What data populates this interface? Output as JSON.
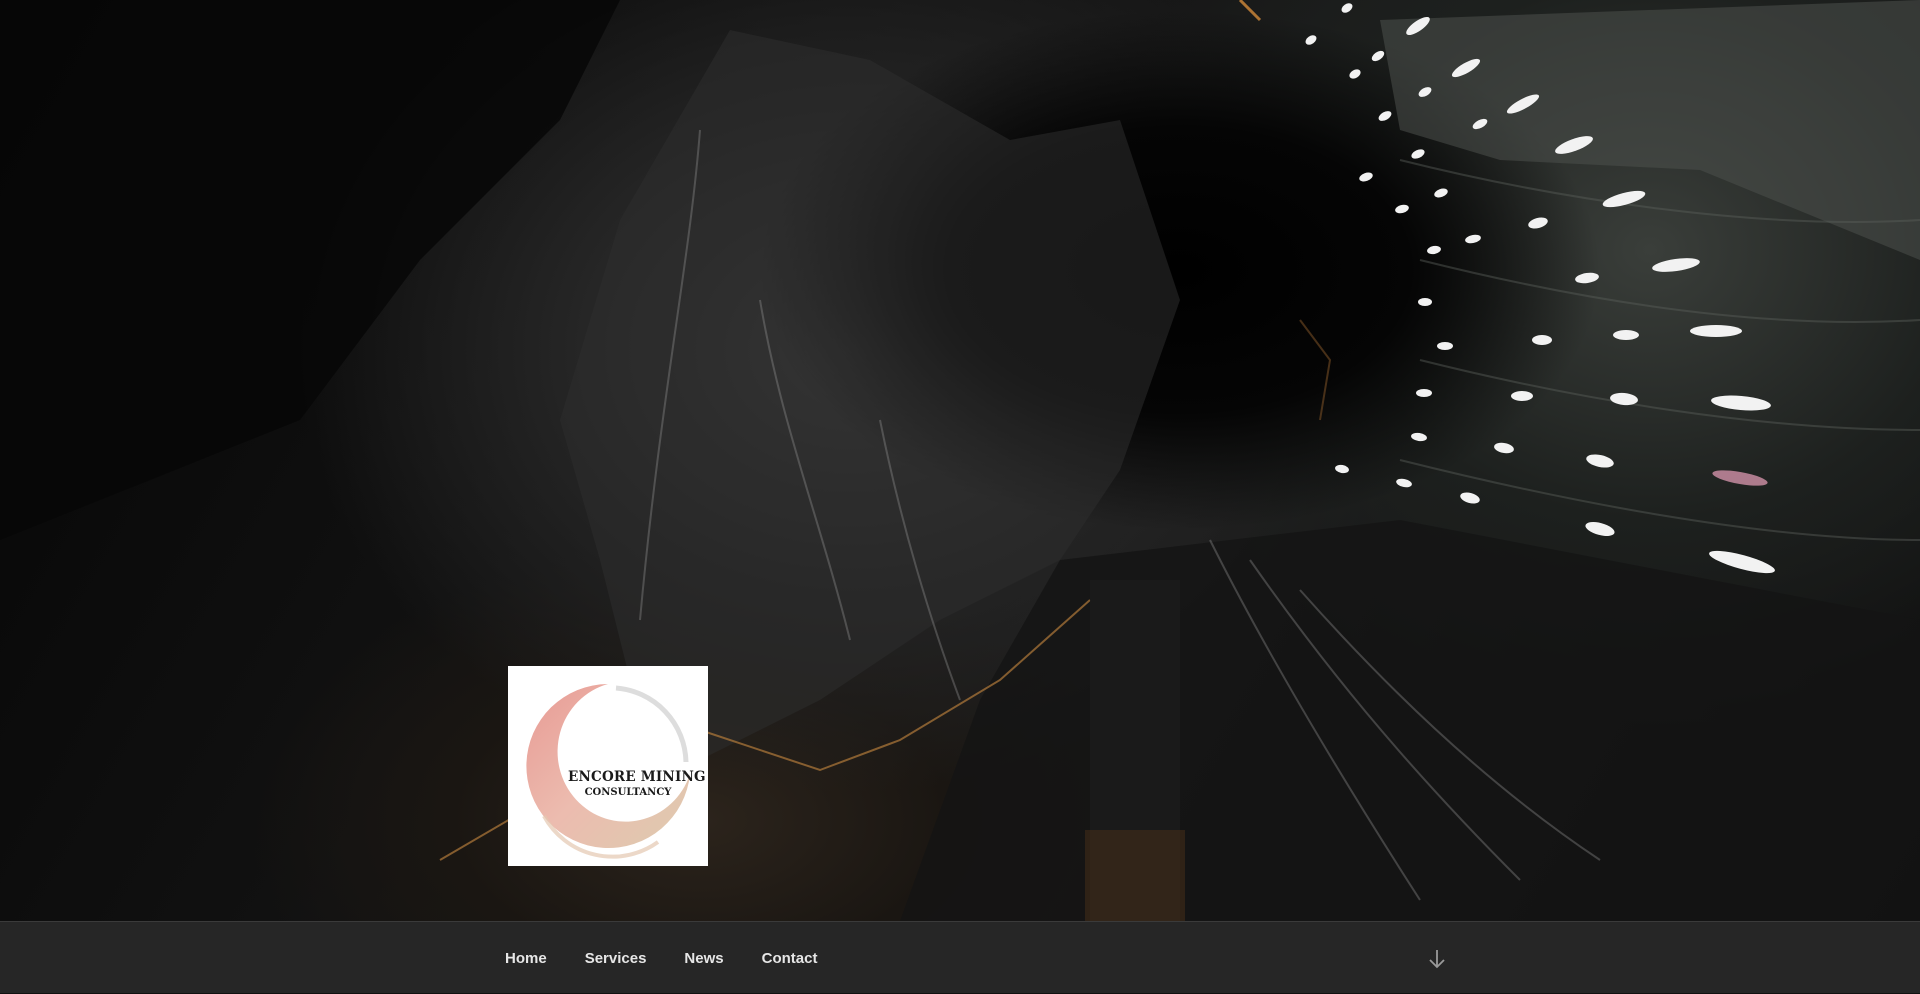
{
  "header": {
    "background_image": "salt-mine-cave-photo",
    "logo": {
      "line1": "ENCORE MINING",
      "line2": "CONSULTANCY",
      "ring_color": "#e8a49a"
    }
  },
  "navigation": {
    "items": [
      {
        "label": "Home"
      },
      {
        "label": "Services"
      },
      {
        "label": "News"
      },
      {
        "label": "Contact"
      }
    ],
    "scroll_icon": "arrow-down-icon"
  },
  "colors": {
    "nav_background": "#262626",
    "nav_text": "#e6e6e6",
    "lamp": "#f2f2f2"
  }
}
